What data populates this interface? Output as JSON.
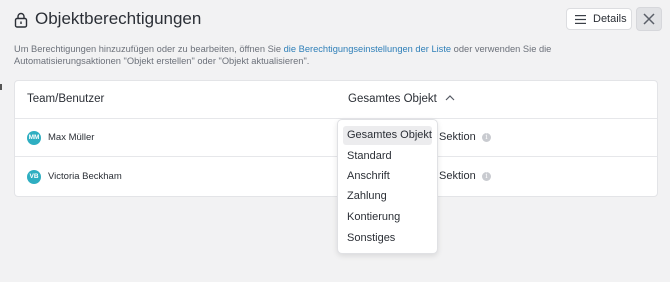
{
  "header": {
    "title": "Objektberechtigungen",
    "details_label": "Details"
  },
  "description": {
    "text_before": "Um Berechtigungen hinzuzufügen oder zu bearbeiten, öffnen Sie ",
    "link": "die Berechtigungseinstellungen der Liste",
    "text_after": " oder verwenden Sie die Automatisierungsaktionen \"Objekt erstellen\" oder \"Objekt aktualisieren\"."
  },
  "table": {
    "col_user": "Team/Benutzer",
    "col_scope": "Gesamtes Objekt",
    "rows": [
      {
        "initials": "MM",
        "name": "Max Müller",
        "scope": "Sektion"
      },
      {
        "initials": "VB",
        "name": "Victoria Beckham",
        "scope": "Sektion"
      }
    ]
  },
  "dropdown": {
    "selected": "Gesamtes Objekt",
    "options": [
      "Gesamtes Objekt",
      "Standard",
      "Anschrift",
      "Zahlung",
      "Kontierung",
      "Sonstiges"
    ]
  },
  "icons": {
    "lock": "lock-icon",
    "menu": "menu-icon",
    "close": "close-icon",
    "chevron": "chevron-up-icon",
    "info": "info-icon"
  },
  "colors": {
    "accent_link": "#2e7fb8",
    "avatar": "#2eaec1",
    "background": "#f2f2f3"
  }
}
